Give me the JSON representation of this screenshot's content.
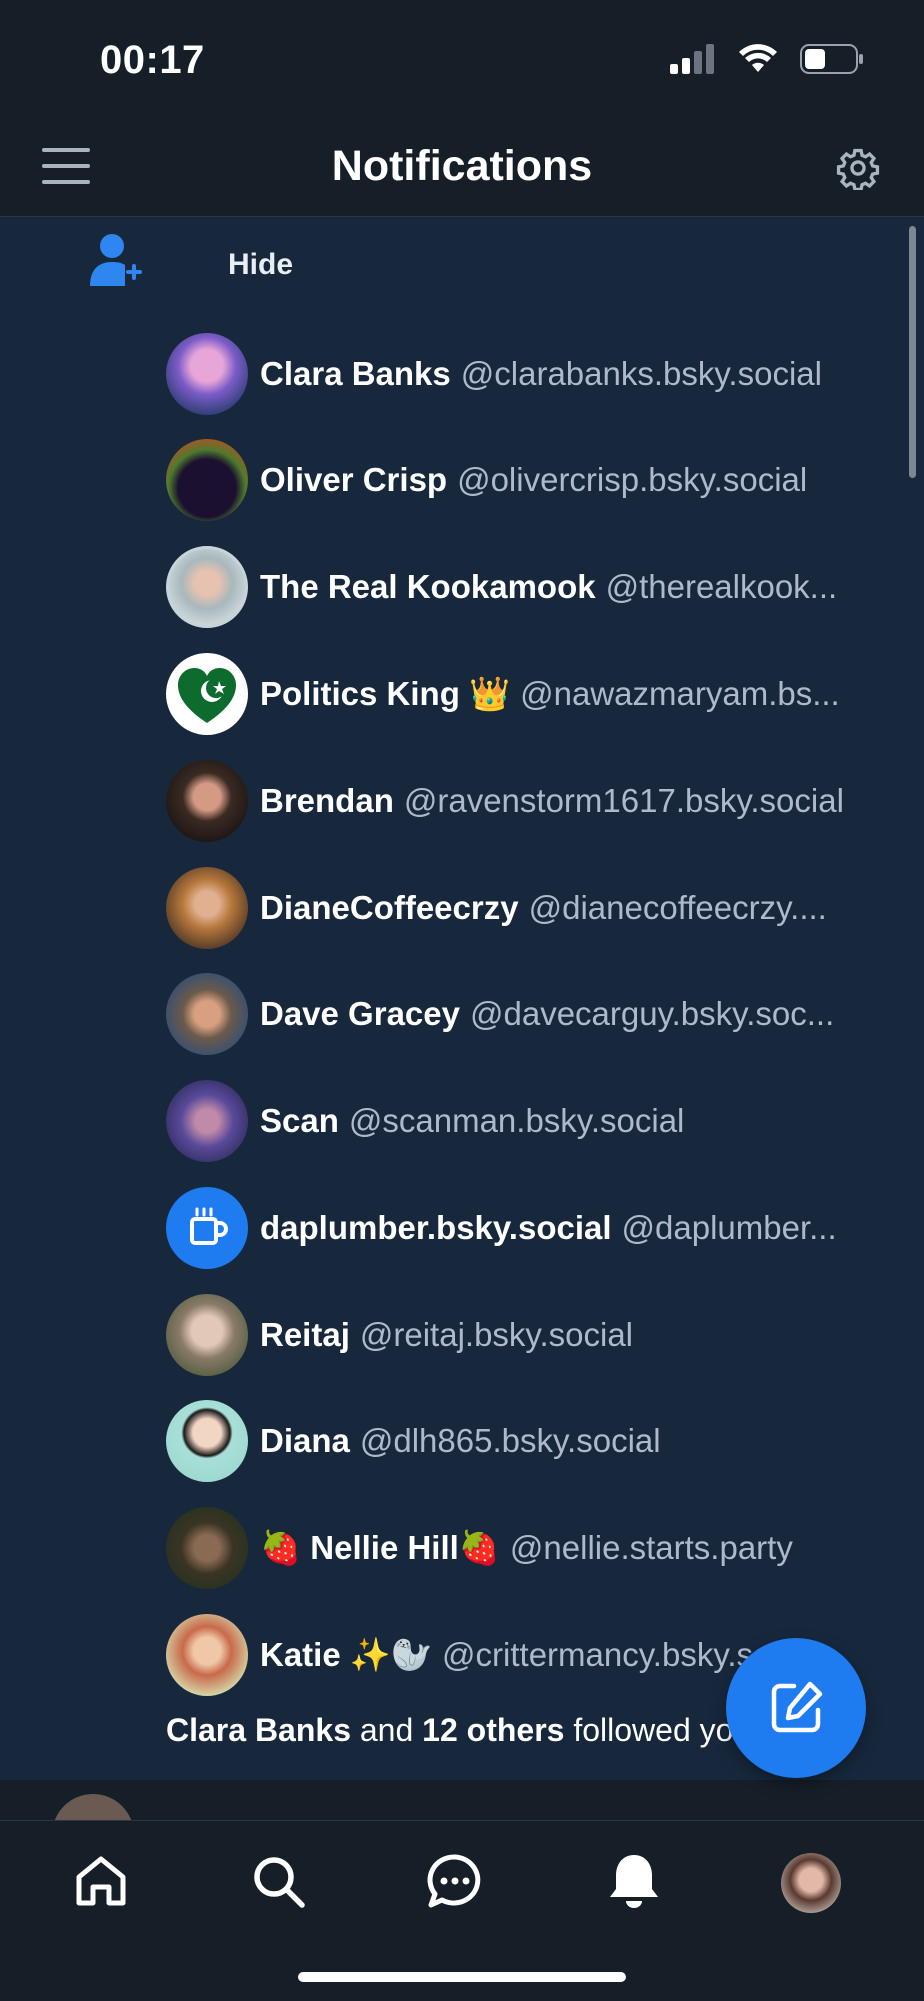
{
  "status_bar": {
    "time": "00:17"
  },
  "header": {
    "title": "Notifications"
  },
  "follow_group": {
    "toggle_label": "Hide",
    "users": [
      {
        "name": "Clara Banks",
        "handle": "@clarabanks.bsky.social"
      },
      {
        "name": "Oliver Crisp",
        "handle": "@olivercrisp.bsky.social"
      },
      {
        "name": "The Real Kookamook",
        "handle": "@therealkook..."
      },
      {
        "name": "Politics King 👑",
        "handle": "@nawazmaryam.bs..."
      },
      {
        "name": "Brendan",
        "handle": "@ravenstorm1617.bsky.social"
      },
      {
        "name": "DianeCoffeecrzy",
        "handle": "@dianecoffeecrzy...."
      },
      {
        "name": "Dave Gracey",
        "handle": "@davecarguy.bsky.soc..."
      },
      {
        "name": "Scan",
        "handle": "@scanman.bsky.social"
      },
      {
        "name": "daplumber.bsky.social",
        "handle": "@daplumber..."
      },
      {
        "name": "Reitaj",
        "handle": "@reitaj.bsky.social"
      },
      {
        "name": "Diana",
        "handle": "@dlh865.bsky.social"
      },
      {
        "name": "🍓 Nellie Hill🍓",
        "handle": "@nellie.starts.party"
      },
      {
        "name": "Katie ✨🦭",
        "handle": "@crittermancy.bsky.social"
      }
    ],
    "summary": {
      "first_name": "Clara Banks",
      "and": "and",
      "others": "12 others",
      "rest": "followed you"
    }
  },
  "tabs": [
    "home-icon",
    "search-icon",
    "chat-icon",
    "notifications-icon",
    "profile-avatar"
  ],
  "colors": {
    "background": "#161e27",
    "card": "#17283d",
    "accent": "#1f7cf0"
  }
}
